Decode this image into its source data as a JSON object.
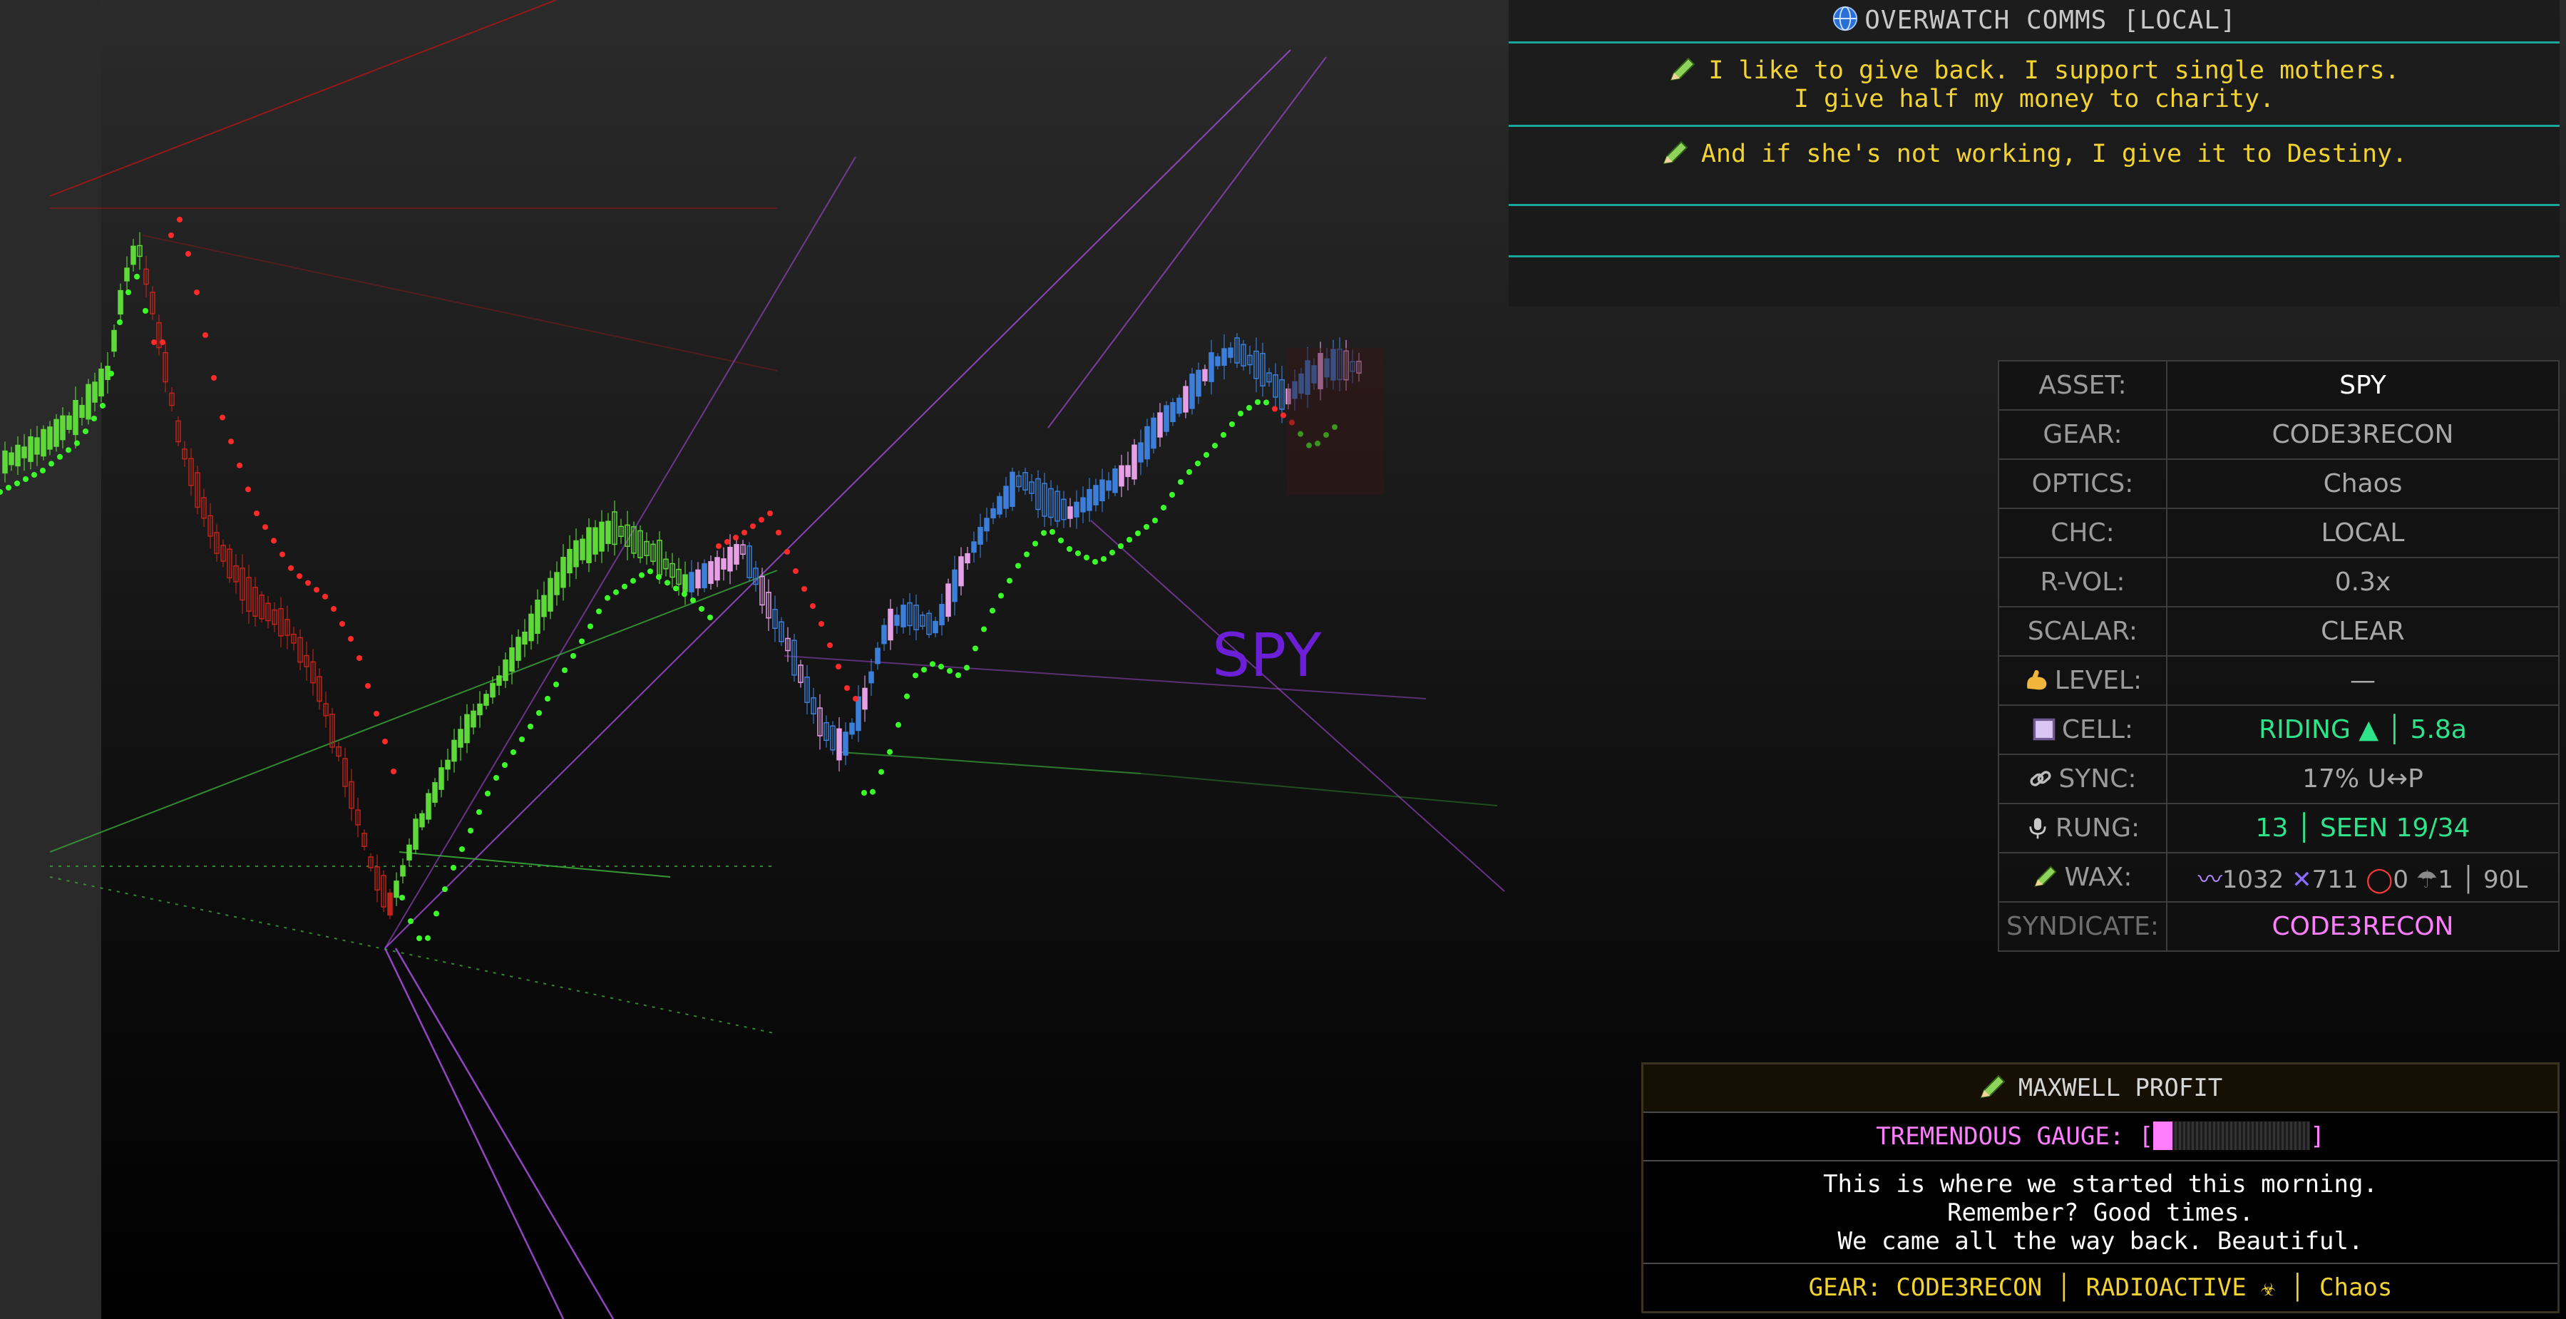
{
  "chart": {
    "watermark_symbol": "SPY",
    "colors": {
      "background": "#000000",
      "sidebar": "#2a2a2a",
      "bear_dots": "#ff2a2a",
      "bull_dots": "#3cff2a",
      "green_candles": "#5fd93a",
      "red_candles": "#c0241a",
      "blue_candles": "#3c7fd9",
      "pink_candles": "#e6a0e6",
      "trend_purple": "#a24bd6",
      "trend_green": "#3aa83a",
      "trend_red": "#a01818"
    }
  },
  "comms": {
    "icon": "globe-icon",
    "title": "OVERWATCH COMMS [LOCAL]",
    "messages": [
      {
        "icon": "pencil-icon",
        "lines": [
          "I like to give back. I support single mothers.",
          "I give half my money to charity."
        ]
      },
      {
        "icon": "pencil-icon",
        "lines": [
          "And if she's not working, I give it to Destiny."
        ]
      }
    ]
  },
  "info": {
    "rows": [
      {
        "key": "ASSET:",
        "value": "SPY",
        "color": "#ffffff"
      },
      {
        "key": "GEAR:",
        "value": "CODE3RECON",
        "color": "#a8a8a8"
      },
      {
        "key": "OPTICS:",
        "value": "Chaos",
        "color": "#a8a8a8"
      },
      {
        "key": "CHC:",
        "value": "LOCAL",
        "color": "#a8a8a8"
      },
      {
        "key": "R-VOL:",
        "value": "0.3x",
        "color": "#a8a8a8"
      },
      {
        "key": "SCALAR:",
        "value": "CLEAR",
        "color": "#a8a8a8"
      },
      {
        "key": "LEVEL:",
        "key_icon": "flexed-bicep-icon",
        "value": "—",
        "color": "#a8a8a8"
      },
      {
        "key": "CELL:",
        "key_icon": "square-icon",
        "value": "RIDING ▲ │ 5.8a",
        "color": "#2ee38a"
      },
      {
        "key": "SYNC:",
        "key_icon": "link-icon",
        "value": "17% U↔P",
        "color": "#a8a8a8"
      },
      {
        "key": "RUNG:",
        "key_icon": "microphone-icon",
        "value": "13 │ SEEN 19/34",
        "color": "#2ee38a"
      },
      {
        "key": "WAX:",
        "key_icon": "pencil-icon",
        "wax": {
          "wave": "1032",
          "cross": "711",
          "circle": "0",
          "umbrella": "1",
          "tail": "│ 90L"
        },
        "color": "#a8a8a8"
      },
      {
        "key": "SYNDICATE:",
        "value": "CODE3RECON",
        "color": "#ff7dff"
      }
    ]
  },
  "maxwell": {
    "icon": "pencil-icon",
    "title": "MAXWELL PROFIT",
    "gauge_label": "TREMENDOUS GAUGE: [",
    "gauge_close": "]",
    "gauge_fill": 0.12,
    "quote": [
      "This is where we started this morning.",
      "Remember? Good times.",
      "We came all the way back. Beautiful."
    ],
    "footer": "GEAR: CODE3RECON │ RADIOACTIVE ☣ │ Chaos"
  }
}
